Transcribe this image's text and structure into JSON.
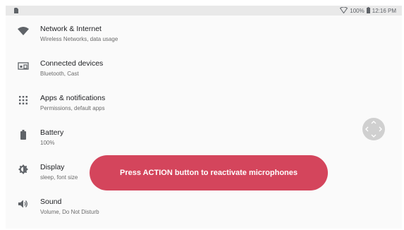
{
  "status_bar": {
    "battery_percent": "100%",
    "time": "12:16 PM",
    "icons": [
      "sim-card-icon",
      "wifi-icon",
      "battery-icon"
    ]
  },
  "settings": {
    "items": [
      {
        "title": "Network & Internet",
        "subtitle": "Wireless Networks, data usage",
        "icon": "wifi-icon"
      },
      {
        "title": "Connected devices",
        "subtitle": "Bluetooth, Cast",
        "icon": "devices-icon"
      },
      {
        "title": "Apps & notifications",
        "subtitle": "Permissions, default apps",
        "icon": "apps-grid-icon"
      },
      {
        "title": "Battery",
        "subtitle": "100%",
        "icon": "battery-icon"
      },
      {
        "title": "Display",
        "subtitle": "sleep, font size",
        "icon": "brightness-icon"
      },
      {
        "title": "Sound",
        "subtitle": "Volume, Do Not Disturb",
        "icon": "volume-icon"
      }
    ]
  },
  "toast": {
    "message": "Press ACTION button to reactivate microphones",
    "color": "#d4455c"
  }
}
